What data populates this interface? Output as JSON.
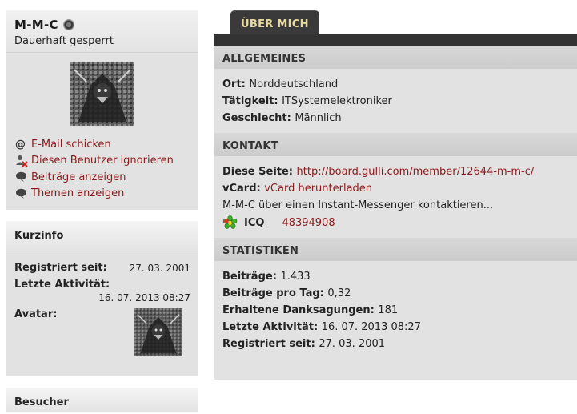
{
  "profile": {
    "username": "M-M-C",
    "user_title": "Dauerhaft gesperrt",
    "actions": [
      {
        "label": "E-Mail schicken",
        "icon": "at-icon"
      },
      {
        "label": "Diesen Benutzer ignorieren",
        "icon": "ignore-user-icon"
      },
      {
        "label": "Beiträge anzeigen",
        "icon": "speech-bubble-icon"
      },
      {
        "label": "Themen anzeigen",
        "icon": "speech-bubble-icon"
      }
    ]
  },
  "kurzinfo": {
    "title": "Kurzinfo",
    "registered_label": "Registriert seit:",
    "registered_value": "27. 03. 2001",
    "last_activity_label": "Letzte Aktivität:",
    "last_activity_value": "16. 07. 2013 08:27",
    "avatar_label": "Avatar:"
  },
  "besucher": {
    "title": "Besucher"
  },
  "tab": {
    "label": "ÜBER MICH"
  },
  "sections": {
    "allgemeines": {
      "title": "ALLGEMEINES",
      "ort_label": "Ort:",
      "ort_value": "Norddeutschland",
      "taetigkeit_label": "Tätigkeit:",
      "taetigkeit_value": "ITSystemelektroniker",
      "geschlecht_label": "Geschlecht:",
      "geschlecht_value": "Männlich"
    },
    "kontakt": {
      "title": "KONTAKT",
      "page_label": "Diese Seite:",
      "page_value": "http://board.gulli.com/member/12644-m-m-c/",
      "vcard_label": "vCard:",
      "vcard_value": "vCard herunterladen",
      "messenger_text": "M-M-C über einen Instant-Messenger kontaktieren...",
      "icq_name": "ICQ",
      "icq_number": "48394908"
    },
    "statistiken": {
      "title": "STATISTIKEN",
      "posts_label": "Beiträge:",
      "posts_value": "1.433",
      "posts_per_day_label": "Beiträge pro Tag:",
      "posts_per_day_value": "0,32",
      "thanks_label": "Erhaltene Danksagungen:",
      "thanks_value": "181",
      "last_activity_label": "Letzte Aktivität:",
      "last_activity_value": "16. 07. 2013 08:27",
      "registered_label": "Registriert seit:",
      "registered_value": "27. 03. 2001"
    }
  },
  "colors": {
    "link": "#8b1a1a",
    "tab_text": "#e8d9a0",
    "tab_bg": "#3a3a3a",
    "panel_bg": "#e2e2e2"
  }
}
